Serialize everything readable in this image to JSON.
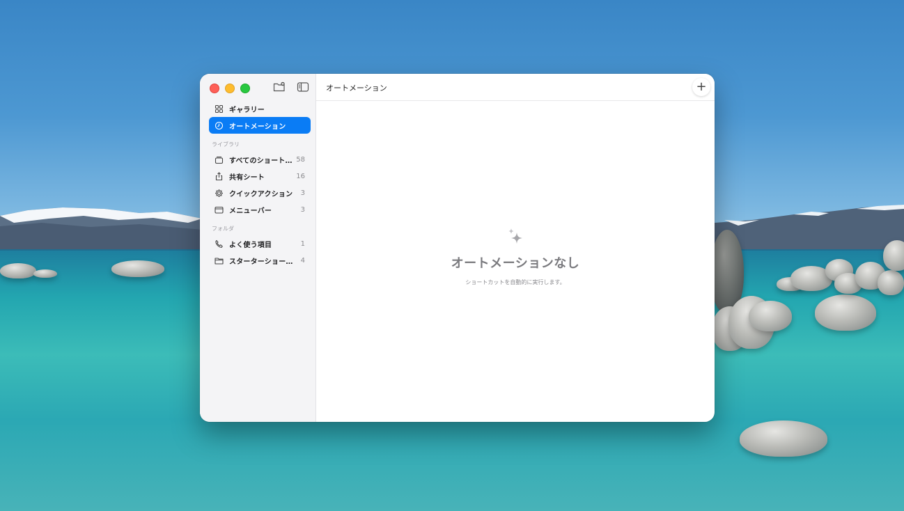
{
  "window": {
    "title": "オートメーション",
    "add_label": "+"
  },
  "sidebar": {
    "top_items": [
      {
        "label": "ギャラリー",
        "icon": "grid-icon"
      },
      {
        "label": "オートメーション",
        "icon": "clock-icon",
        "active": true
      }
    ],
    "library": {
      "label": "ライブラリ",
      "items": [
        {
          "label": "すべてのショートカ…",
          "count": "58",
          "icon": "stack-icon"
        },
        {
          "label": "共有シート",
          "count": "16",
          "icon": "share-icon"
        },
        {
          "label": "クイックアクション",
          "count": "3",
          "icon": "gear-icon"
        },
        {
          "label": "メニューバー",
          "count": "3",
          "icon": "menubar-icon"
        }
      ]
    },
    "folders": {
      "label": "フォルダ",
      "items": [
        {
          "label": "よく使う項目",
          "count": "1",
          "icon": "phone-icon"
        },
        {
          "label": "スターターショートカ…",
          "count": "4",
          "icon": "folder-icon"
        }
      ]
    }
  },
  "empty_state": {
    "title": "オートメーションなし",
    "subtitle": "ショートカットを自動的に実行します。",
    "icon": "sparkle-icon"
  },
  "colors": {
    "accent": "#0a7cf5",
    "close": "#fe5f57",
    "minimize": "#febc2e",
    "zoom": "#28c840"
  }
}
